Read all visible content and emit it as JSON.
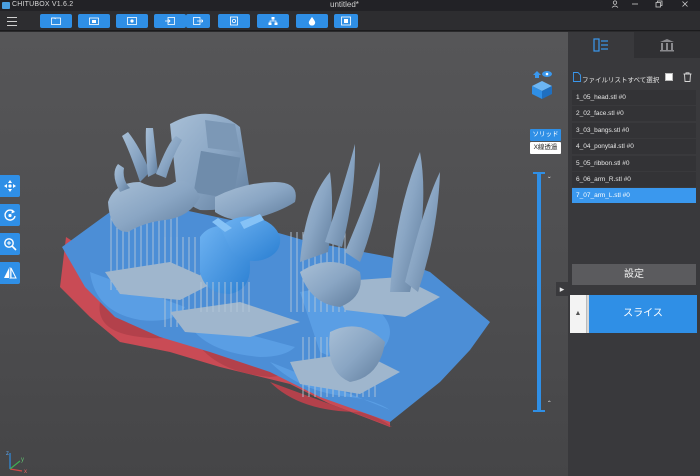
{
  "titlebar": {
    "app_name": "CHITUBOX V1.6.2",
    "document_title": "untitled*",
    "icons": [
      "user-icon",
      "minimize-icon",
      "restore-icon",
      "close-icon"
    ]
  },
  "toolbar": {
    "icons": [
      "hamburger-menu-icon",
      "open-file-icon",
      "open-project-icon",
      "image-icon",
      "import-icon",
      "export-icon",
      "machine-settings-icon",
      "network-icon",
      "resin-icon",
      "screenshot-icon"
    ],
    "accent": "#2f8fe6"
  },
  "viewport": {
    "left_tools": [
      "move-icon",
      "rotate-icon",
      "scale-icon",
      "mirror-icon"
    ],
    "render_mode": {
      "solid": "ソリッド",
      "xray": "X線透過"
    },
    "layer_slider": {
      "up_arrow": "ˇ",
      "down_arrow": "ˆ"
    },
    "axis_labels": {
      "x": "x",
      "y": "y",
      "z": "z"
    },
    "collapse_arrow": "▸"
  },
  "right_panel": {
    "tabs": [
      "model-list-icon",
      "support-icon"
    ],
    "select_all_label": "ファイルリストすべて選択",
    "files": [
      "1_05_head.stl #0",
      "2_02_face.stl #0",
      "3_03_bangs.stl #0",
      "4_04_ponytail.stl #0",
      "5_05_ribbon.stl #0",
      "6_06_arm_R.stl #0",
      "7_07_arm_L.stl #0"
    ],
    "selected_index": 6,
    "settings_label": "設定",
    "slice_arrow": "▲",
    "slice_label": "スライス"
  },
  "colors": {
    "model": "#8aa6c4",
    "selected_model": "#3a98ee",
    "plate": "#4c8ed6",
    "plate_outside": "#c94b55"
  }
}
